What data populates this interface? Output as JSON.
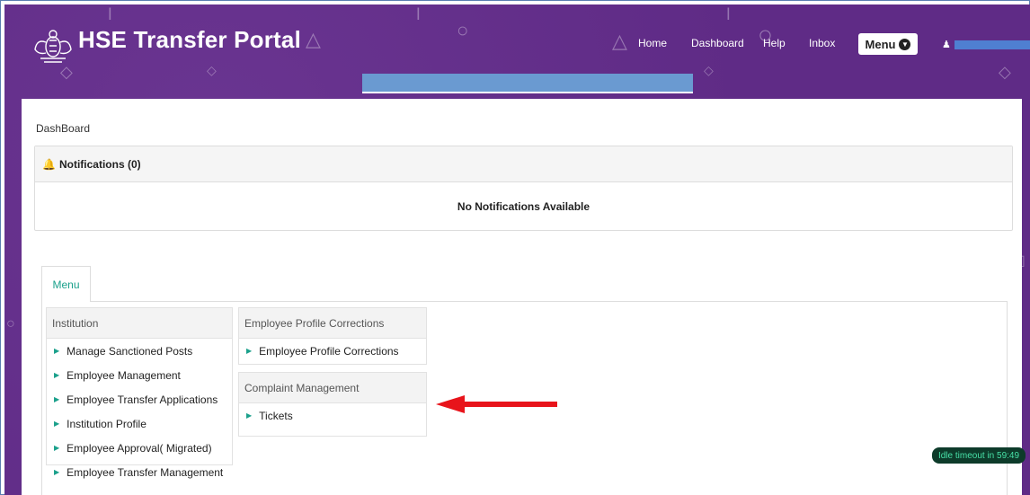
{
  "header": {
    "brand": "HSE Transfer Portal",
    "logo_icon": "kerala-emblem-icon",
    "nav": [
      "Home",
      "Dashboard",
      "Help",
      "Inbox"
    ],
    "menu_label": "Menu",
    "user_name_redacted": true,
    "colors": {
      "header_bg": "#5f2b86",
      "accent": "#1aa08b",
      "redaction": "#6a9ad1"
    }
  },
  "breadcrumb": "DashBoard",
  "notifications": {
    "title": "Notifications (0)",
    "empty_text": "No Notifications Available"
  },
  "menu_tab": {
    "label": "Menu"
  },
  "sections": [
    {
      "title": "Institution",
      "items": [
        "Manage Sanctioned Posts",
        "Employee Management",
        "Employee Transfer Applications",
        "Institution Profile",
        "Employee Approval( Migrated)",
        "Employee Transfer Management"
      ]
    },
    {
      "title": "Employee Profile Corrections",
      "items": [
        "Employee Profile Corrections"
      ]
    },
    {
      "title": "Complaint Management",
      "items": [
        "Tickets"
      ]
    }
  ],
  "idle_timeout": "Idle timeout in 59:49"
}
